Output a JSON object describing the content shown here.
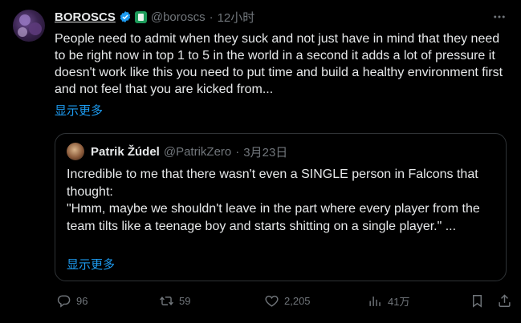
{
  "tweet": {
    "author_name": "BOROSCS",
    "handle": "@boroscs",
    "separator": "·",
    "time": "12小时",
    "text": "People need to admit when they suck and not just have in mind that they need to be right now in top 1 to 5 in the world in a second it adds a lot of pressure it doesn't work like this you need to put time and build a healthy environment first and not feel that you are kicked from...",
    "show_more": "显示更多"
  },
  "quote": {
    "author_name": "Patrik Žúdel",
    "handle": "@PatrikZero",
    "separator": "·",
    "time": "3月23日",
    "line1": "Incredible to me that there wasn't even a SINGLE person in Falcons that thought:",
    "line2": "\"Hmm, maybe we shouldn't leave in the part where every player from the team tilts like a teenage boy and starts shitting on a single player.\" ...",
    "show_more": "显示更多"
  },
  "actions": {
    "replies": "96",
    "retweets": "59",
    "likes": "2,205",
    "views": "41万"
  },
  "icons": {
    "verified": "verified-badge-icon",
    "affiliate": "affiliate-badge-icon",
    "more": "more-icon",
    "reply": "reply-icon",
    "retweet": "retweet-icon",
    "like": "heart-icon",
    "views": "views-icon",
    "bookmark": "bookmark-icon",
    "share": "share-icon"
  },
  "colors": {
    "background": "#000000",
    "text": "#e7e9ea",
    "muted": "#71767b",
    "link": "#1d9bf0",
    "border": "#2f3336",
    "verified": "#1d9bf0"
  }
}
